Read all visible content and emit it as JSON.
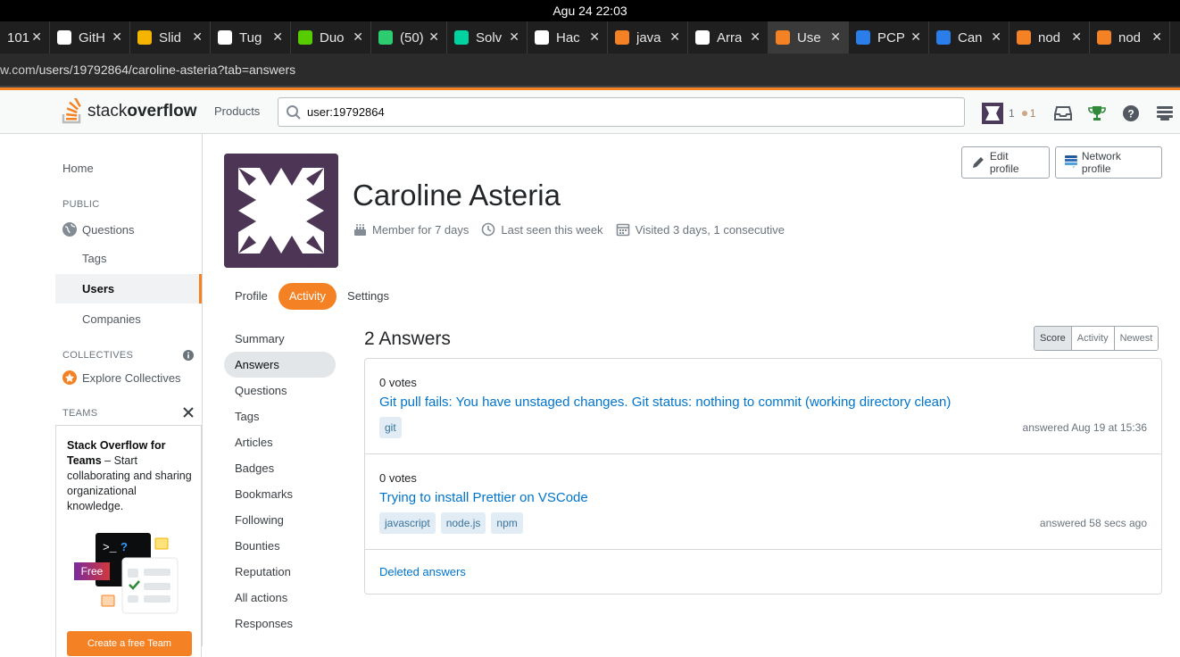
{
  "os": {
    "datetime": "Agu 24  22:03"
  },
  "browser": {
    "tabs": [
      {
        "label": "101",
        "favicon": "generic",
        "color": "#888888",
        "active": false
      },
      {
        "label": "GitH",
        "favicon": "github-icon",
        "color": "#ffffff",
        "active": false
      },
      {
        "label": "Slid",
        "favicon": "google-drive-icon",
        "color": "#f4b400",
        "active": false
      },
      {
        "label": "Tug",
        "favicon": "github-icon",
        "color": "#ffffff",
        "active": false
      },
      {
        "label": "Duo",
        "favicon": "duolingo-icon",
        "color": "#58cc02",
        "active": false
      },
      {
        "label": "(50)",
        "favicon": "sg-icon",
        "color": "#2ecc71",
        "active": false
      },
      {
        "label": "Solv",
        "favicon": "n-icon",
        "color": "#00d2a0",
        "active": false
      },
      {
        "label": "Hac",
        "favicon": "dev-icon",
        "color": "#ffffff",
        "active": false
      },
      {
        "label": "java",
        "favicon": "stackoverflow-icon",
        "color": "#f48225",
        "active": false
      },
      {
        "label": "Arra",
        "favicon": "medium-icon",
        "color": "#ffffff",
        "active": false
      },
      {
        "label": "Use",
        "favicon": "stackoverflow-icon",
        "color": "#f48225",
        "active": true
      },
      {
        "label": "PCP",
        "favicon": "b-icon",
        "color": "#2b7de9",
        "active": false
      },
      {
        "label": "Can",
        "favicon": "b-icon",
        "color": "#2b7de9",
        "active": false
      },
      {
        "label": "nod",
        "favicon": "stackoverflow-icon",
        "color": "#f48225",
        "active": false
      },
      {
        "label": "nod",
        "favicon": "stackoverflow-icon",
        "color": "#f48225",
        "active": false
      }
    ],
    "url": {
      "host": "w.com",
      "path": "/users/19792864/caroline-asteria?tab=answers"
    }
  },
  "header": {
    "logo_text_light": "stack",
    "logo_text_bold": "overflow",
    "products_label": "Products",
    "search_value": "user:19792864",
    "rep": "1",
    "bronze": "1"
  },
  "leftnav": {
    "home": "Home",
    "public_heading": "PUBLIC",
    "questions": "Questions",
    "tags": "Tags",
    "users": "Users",
    "companies": "Companies",
    "collectives_heading": "COLLECTIVES",
    "explore_collectives": "Explore Collectives",
    "teams_heading": "TEAMS",
    "teams_title": "Stack Overflow for Teams",
    "teams_body": " – Start collaborating and sharing organizational knowledge.",
    "free_badge": "Free",
    "create_team": "Create a free Team"
  },
  "profile": {
    "name": "Caroline Asteria",
    "member_for": "Member for 7 days",
    "last_seen": "Last seen this week",
    "visited": "Visited 3 days, 1 consecutive",
    "edit_profile": "Edit profile",
    "network_profile": "Network profile",
    "tabs": [
      "Profile",
      "Activity",
      "Settings"
    ],
    "active_tab": "Activity"
  },
  "activity_nav": [
    "Summary",
    "Answers",
    "Questions",
    "Tags",
    "Articles",
    "Badges",
    "Bookmarks",
    "Following",
    "Bounties",
    "Reputation",
    "All actions",
    "Responses"
  ],
  "answers": {
    "title": "2 Answers",
    "sort": [
      "Score",
      "Activity",
      "Newest"
    ],
    "sort_selected": "Score",
    "items": [
      {
        "votes": "0 votes",
        "title": "Git pull fails: You have unstaged changes. Git status: nothing to commit (working directory clean)",
        "tags": [
          "git"
        ],
        "when": "answered Aug 19 at 15:36"
      },
      {
        "votes": "0 votes",
        "title": "Trying to install Prettier on VSCode",
        "tags": [
          "javascript",
          "node.js",
          "npm"
        ],
        "when": "answered 58 secs ago"
      }
    ],
    "deleted_link": "Deleted answers"
  }
}
